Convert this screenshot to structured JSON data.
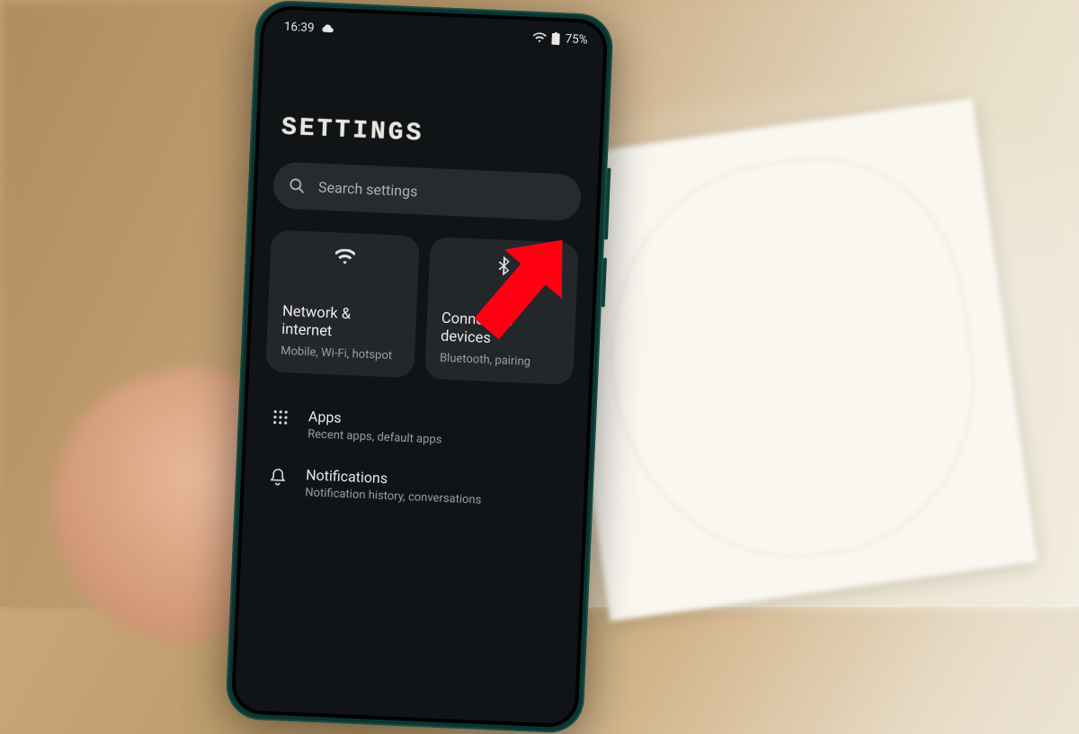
{
  "statusbar": {
    "time": "16:39",
    "battery_text": "75%"
  },
  "page": {
    "title": "SETTINGS"
  },
  "search": {
    "placeholder": "Search settings"
  },
  "tiles": [
    {
      "title": "Network & internet",
      "subtitle": "Mobile, Wi-Fi, hotspot"
    },
    {
      "title": "Connected devices",
      "subtitle": "Bluetooth, pairing"
    }
  ],
  "list": [
    {
      "title": "Apps",
      "subtitle": "Recent apps, default apps"
    },
    {
      "title": "Notifications",
      "subtitle": "Notification history, conversations"
    }
  ],
  "annotation": {
    "arrow_color": "#ff0000"
  }
}
